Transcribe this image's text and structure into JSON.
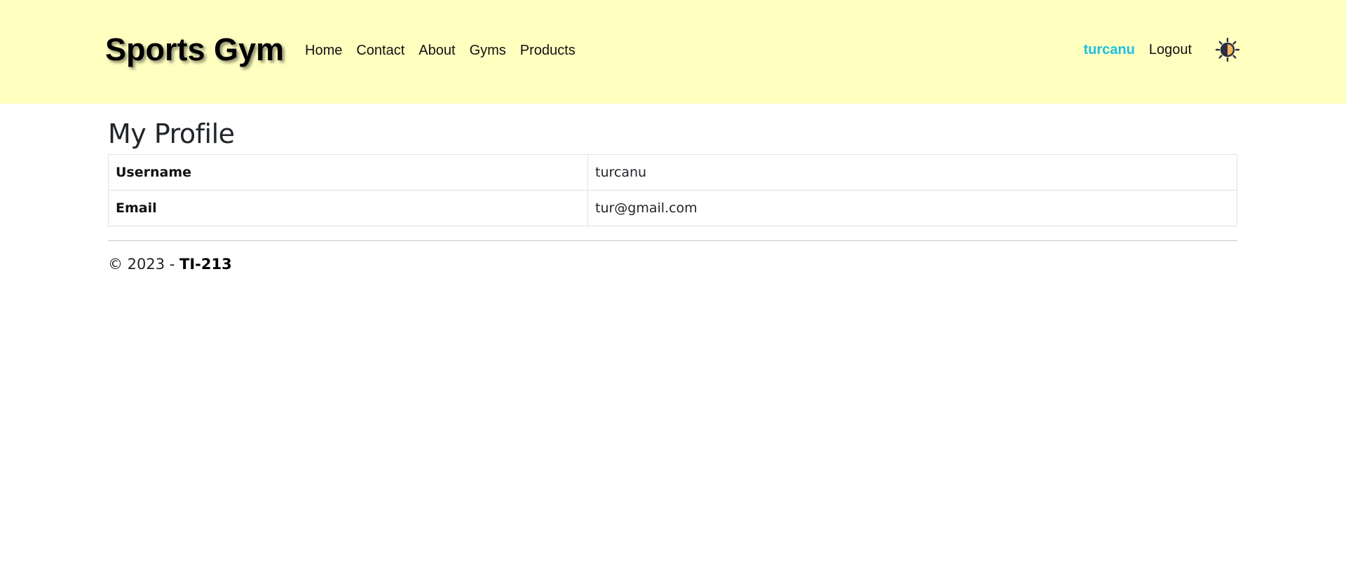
{
  "navbar": {
    "brand": "Sports Gym",
    "links": [
      "Home",
      "Contact",
      "About",
      "Gyms",
      "Products"
    ],
    "user": "turcanu",
    "logout": "Logout",
    "theme_icon": "theme-toggle-icon",
    "background_color": "#ffffc0",
    "user_color": "#1ec0e6"
  },
  "main": {
    "title": "My Profile",
    "rows": [
      {
        "label": "Username",
        "value": "turcanu"
      },
      {
        "label": "Email",
        "value": "tur@gmail.com"
      }
    ]
  },
  "footer": {
    "prefix": "© 2023 - ",
    "org": "TI-213"
  }
}
